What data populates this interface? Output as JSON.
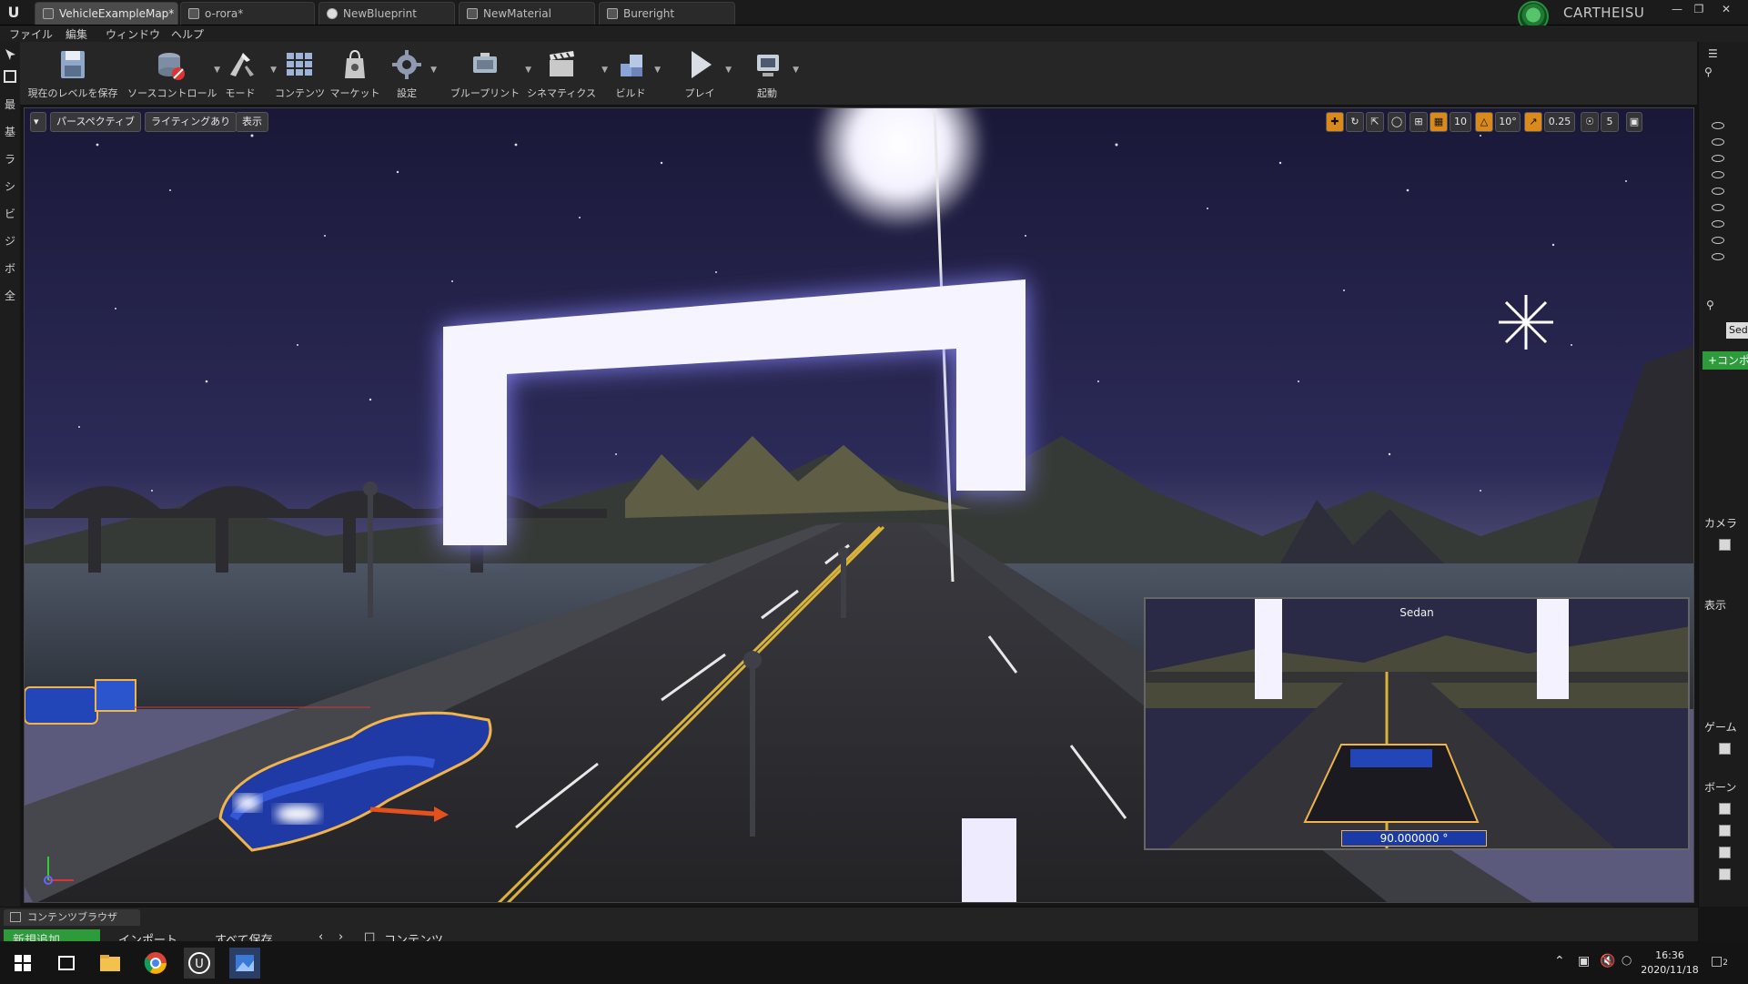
{
  "tabs": [
    {
      "label": "VehicleExampleMap*",
      "active": true
    },
    {
      "label": "o-rora*"
    },
    {
      "label": "NewBlueprint"
    },
    {
      "label": "NewMaterial"
    },
    {
      "label": "Bureright"
    }
  ],
  "user": {
    "name": "CARTHEISU"
  },
  "menu": [
    "ファイル",
    "編集",
    "ウィンドウ",
    "ヘルプ"
  ],
  "toolbar": {
    "save_level": "現在のレベルを保存",
    "source_control": "ソースコントロール",
    "modes": "モード",
    "content": "コンテンツ",
    "marketplace": "マーケット",
    "settings": "設定",
    "blueprints": "ブループリント",
    "cinematics": "シネマティクス",
    "build": "ビルド",
    "play": "プレイ",
    "launch": "起動"
  },
  "mode_strip": [
    "最",
    "基",
    "ラ",
    "シ",
    "ビ",
    "ジ",
    "ボ",
    "全"
  ],
  "viewport": {
    "perspective": "パースペクティブ",
    "lighting": "ライティングあり",
    "show": "表示",
    "grid_snap": "10",
    "rotation_snap": "10°",
    "scale_snap": "0.25",
    "camera_speed": "5"
  },
  "pip": {
    "title": "Sedan",
    "angle": "90.000000 °"
  },
  "right_panel": {
    "search_value": "Sedan",
    "add_component": "+コンポーネントを追加",
    "section_camera": "カメラ",
    "section_render": "表示",
    "section_game": "ゲーム",
    "section_bone": "ボーン"
  },
  "content_browser": {
    "tab_label": "コンテンツブラウザ",
    "add_new": "新規追加",
    "import": "インポート",
    "save_all": "すべて保存",
    "path": "コンテンツ"
  },
  "taskbar": {
    "time": "16:36",
    "date": "2020/11/18",
    "notifications": "2"
  },
  "colors": {
    "accent_green": "#2e9b3b",
    "selection_orange": "#f0b44a",
    "portal_glow": "#c9c4ff",
    "night_sky": "#1f1d44"
  }
}
